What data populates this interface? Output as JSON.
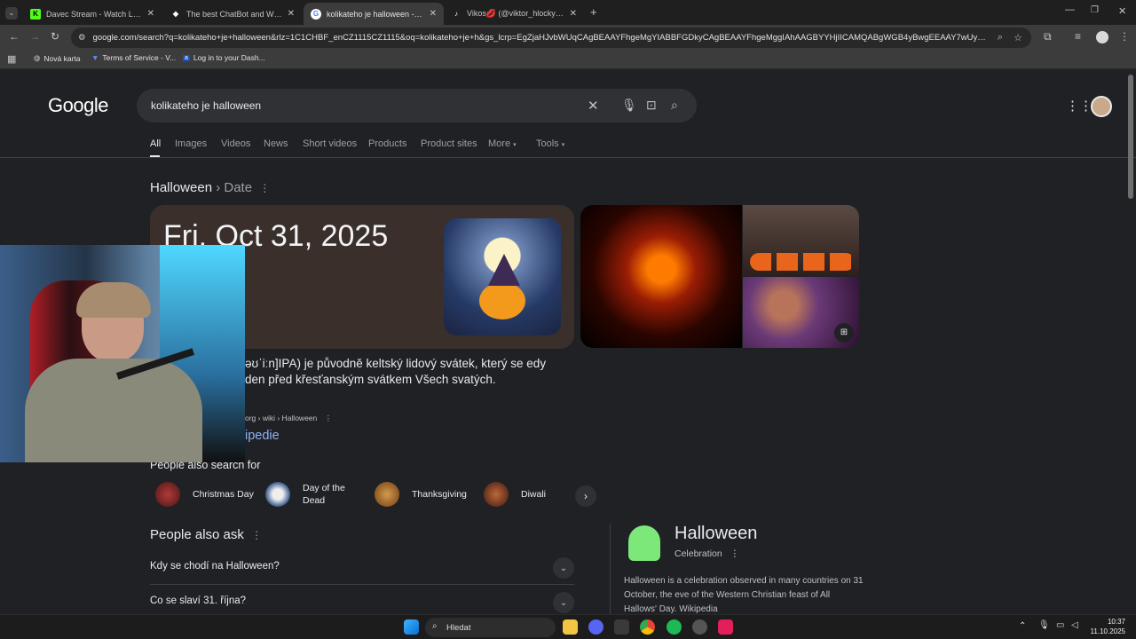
{
  "browser": {
    "tabs": [
      {
        "title": "Davec Stream - Watch Live on K",
        "favicon": "kick-icon",
        "color": "#53fc18"
      },
      {
        "title": "The best ChatBot and Widgets",
        "favicon": "botrix-icon",
        "color": "#ffffff"
      },
      {
        "title": "kolikateho je halloween - Goog",
        "favicon": "google-icon",
        "color": "#ffffff"
      },
      {
        "title": "Vikos💋 (@viktor_hlocky) | TikT",
        "favicon": "tiktok-icon",
        "color": "#ffffff"
      }
    ],
    "url": "google.com/search?q=kolikateho+je+halloween&rlz=1C1CHBF_enCZ1115CZ1115&oq=kolikateho+je+h&gs_lcrp=EgZjaHJvbWUqCAgBEAAYFhgeMgYIABBFGDkyCAgBEAAYFhgeMggIAhAAGBYYHjIICAMQABgWGB4yBwgEEAAY7wUyBwgFEAAY7...",
    "bookmarks": [
      "Nová karta",
      "Terms of Service - V...",
      "Log in to your Dash..."
    ]
  },
  "google": {
    "logo": "Google",
    "query": "kolikateho je halloween",
    "tabs": [
      "All",
      "Images",
      "Videos",
      "News",
      "Short videos",
      "Products",
      "Product sites",
      "More",
      "Tools"
    ],
    "crumb_main": "Halloween",
    "crumb_sub": "› Date",
    "date": "Fri, Oct 31, 2025",
    "description": "əʊˈiːn]IPA) je původně keltský lidový svátek, který se edy den před křesťanským svátkem Všech svatých.",
    "wiki_source": "org › wiki › Halloween",
    "wiki_link": "ipedie",
    "people_also_search": "People also search for",
    "chips": [
      "Christmas Day",
      "Day of the Dead",
      "Thanksgiving",
      "Diwali"
    ],
    "people_also_ask": "People also ask",
    "questions": [
      "Kdy se chodí na Halloween?",
      "Co se slaví 31. října?"
    ],
    "kp_title": "Halloween",
    "kp_sub": "Celebration",
    "kp_desc": "Halloween is a celebration observed in many countries on 31 October, the eve of the Western Christian feast of All Hallows' Day. Wikipedia"
  },
  "taskbar": {
    "search": "Hledat",
    "time": "10:37",
    "date": "11.10.2025"
  }
}
